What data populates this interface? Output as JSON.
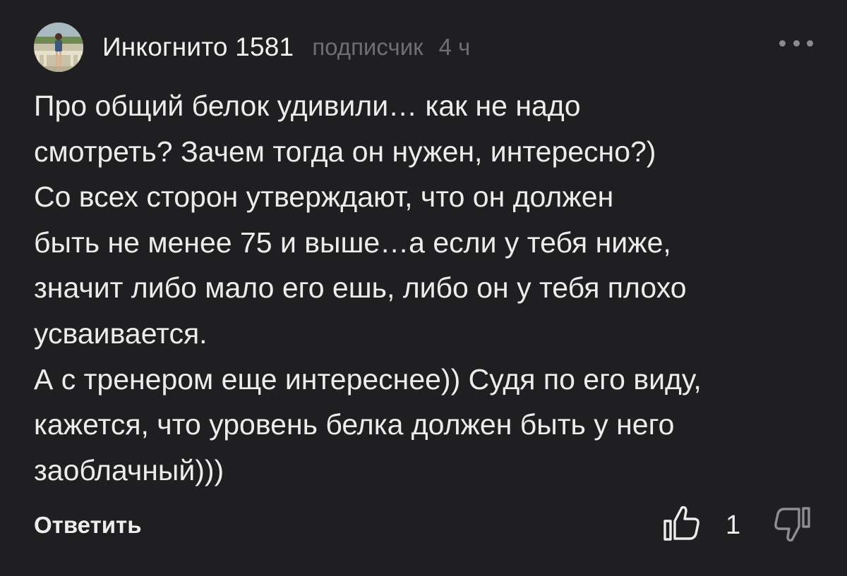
{
  "comment": {
    "author": "Инкогнито 1581",
    "role": "подписчик",
    "time": "4 ч",
    "avatar_icon": "user-avatar-photo",
    "more_icon": "more-dots-icon",
    "text": {
      "line1": "Про общий белок удивили… как не надо",
      "line2": "смотреть? Зачем тогда он нужен, интересно?)",
      "line3": "Со всех сторон утверждают, что он должен",
      "line4": "быть не менее 75 и выше…а если у тебя ниже,",
      "line5": "значит либо мало его ешь, либо он у тебя плохо",
      "line6": "усваивается.",
      "line7": "А с тренером еще интереснее)) Судя по его виду,",
      "line8": "кажется, что уровень белка должен быть у него",
      "line9": "заоблачный)))"
    },
    "actions": {
      "reply_label": "Ответить",
      "like_icon": "thumb-up-icon",
      "like_count": "1",
      "dislike_icon": "thumb-down-icon"
    }
  },
  "colors": {
    "background": "#1f1f21",
    "text": "#ececec",
    "muted": "#6f6f73"
  }
}
